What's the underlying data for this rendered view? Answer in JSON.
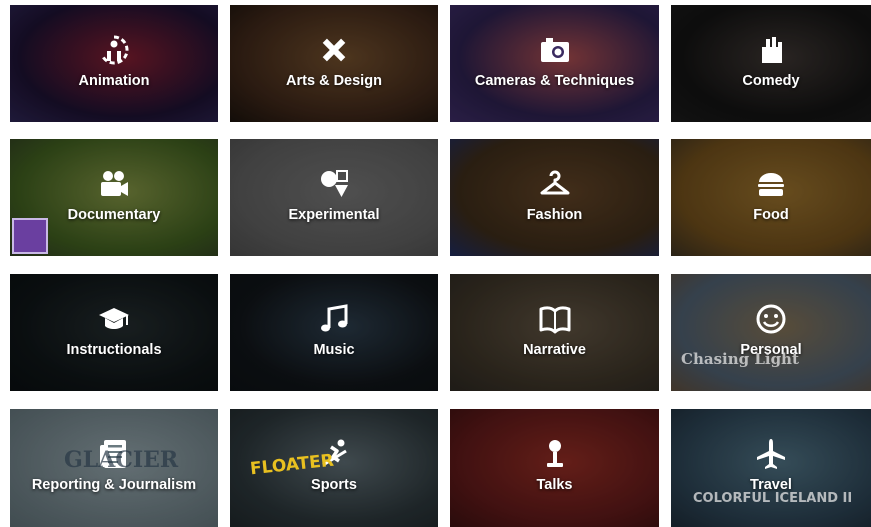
{
  "categories": [
    {
      "label": "Animation",
      "icon": "animation-icon",
      "colors": [
        "#1c1130",
        "#7a1c2e",
        "#2b2450"
      ]
    },
    {
      "label": "Arts & Design",
      "icon": "pencil-ruler-icon",
      "colors": [
        "#3b2518",
        "#6b4a2a",
        "#1a120c"
      ]
    },
    {
      "label": "Cameras & Techniques",
      "icon": "camera-icon",
      "colors": [
        "#2a1f4a",
        "#a0484a",
        "#3a2a60"
      ]
    },
    {
      "label": "Comedy",
      "icon": "clapping-hand-icon",
      "colors": [
        "#121212",
        "#3a3330",
        "#1a1a1a"
      ]
    },
    {
      "label": "Documentary",
      "icon": "video-camera-icon",
      "colors": [
        "#3d5a1e",
        "#7a8a40",
        "#2d3a20"
      ]
    },
    {
      "label": "Experimental",
      "icon": "shapes-icon",
      "colors": [
        "#5a5a5a",
        "#6e6e6e",
        "#4a4a4a"
      ]
    },
    {
      "label": "Fashion",
      "icon": "hanger-icon",
      "colors": [
        "#3a2a18",
        "#5b3f24",
        "#1e2a5a"
      ]
    },
    {
      "label": "Food",
      "icon": "burger-icon",
      "colors": [
        "#6a4a1a",
        "#8f6a2a",
        "#3a3020"
      ]
    },
    {
      "label": "Instructionals",
      "icon": "graduation-cap-icon",
      "colors": [
        "#0e1416",
        "#222a2c",
        "#0a0e10"
      ]
    },
    {
      "label": "Music",
      "icon": "music-note-icon",
      "colors": [
        "#101418",
        "#2a3a48",
        "#0c1014"
      ]
    },
    {
      "label": "Narrative",
      "icon": "book-icon",
      "colors": [
        "#3a3226",
        "#5a4e3e",
        "#2a2620"
      ]
    },
    {
      "label": "Personal",
      "icon": "smiley-icon",
      "colors": [
        "#4a5a6a",
        "#7a6a50",
        "#5a4a3a"
      ]
    },
    {
      "label": "Reporting & Journalism",
      "icon": "newspaper-icon",
      "colors": [
        "#6a7a80",
        "#8a9aa0",
        "#5a6a70"
      ]
    },
    {
      "label": "Sports",
      "icon": "skier-icon",
      "colors": [
        "#2a3438",
        "#58666c",
        "#1e2629"
      ]
    },
    {
      "label": "Talks",
      "icon": "microphone-icon",
      "colors": [
        "#5a1818",
        "#8a2a22",
        "#3a1010"
      ]
    },
    {
      "label": "Travel",
      "icon": "airplane-icon",
      "colors": [
        "#2a4050",
        "#4a6a7a",
        "#1c2a36"
      ]
    }
  ],
  "overlays": {
    "personal": "Chasing Light",
    "reporting": "GLACIER",
    "sports": "FLOATER",
    "travel": "COLORFUL ICELAND II"
  }
}
